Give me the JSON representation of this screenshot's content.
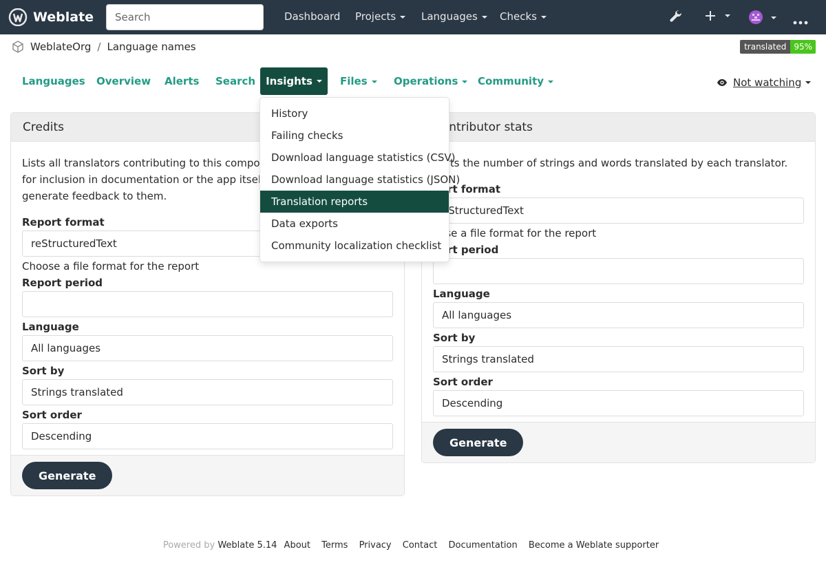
{
  "brand": {
    "name": "Weblate"
  },
  "search": {
    "placeholder": "Search"
  },
  "nav": {
    "dashboard": "Dashboard",
    "projects": "Projects",
    "languages": "Languages",
    "checks": "Checks"
  },
  "breadcrumb": {
    "project": "WeblateOrg",
    "component": "Language names",
    "sep": "/"
  },
  "badge": {
    "label": "translated",
    "value": "95%"
  },
  "tabs": {
    "languages": "Languages",
    "overview": "Overview",
    "alerts": "Alerts",
    "search": "Search",
    "insights": "Insights",
    "files": "Files",
    "operations": "Operations",
    "community": "Community"
  },
  "watch": {
    "label": "Not watching"
  },
  "insights_menu": [
    "History",
    "Failing checks",
    "Download language statistics (CSV)",
    "Download language statistics (JSON)",
    "Translation reports",
    "Data exports",
    "Community localization checklist"
  ],
  "credits": {
    "title": "Credits",
    "description_lines": [
      "Lists all translators contributing to this component in",
      "for inclusion in documentation or the app itself, to th",
      "generate feedback to them."
    ],
    "format_label": "Report format",
    "format_value": "reStructuredText",
    "format_help": "Choose a file format for the report",
    "period_label": "Report period",
    "language_label": "Language",
    "language_value": "All languages",
    "sortby_label": "Sort by",
    "sortby_value": "Strings translated",
    "order_label": "Sort order",
    "order_value": "Descending",
    "generate": "Generate"
  },
  "stats": {
    "title": "Contributor stats",
    "description": "ports the number of strings and words translated by each translator.",
    "format_label": "port format",
    "format_value": "eStructuredText",
    "format_help": "oose a file format for the report",
    "period_label": "port period",
    "language_label": "Language",
    "language_value": "All languages",
    "sortby_label": "Sort by",
    "sortby_value": "Strings translated",
    "order_label": "Sort order",
    "order_value": "Descending",
    "generate": "Generate"
  },
  "footer": {
    "powered_by": "Powered by",
    "version": "Weblate 5.14",
    "about": "About",
    "terms": "Terms",
    "privacy": "Privacy",
    "contact": "Contact",
    "documentation": "Documentation",
    "supporter": "Become a Weblate supporter"
  },
  "colors": {
    "navbar": "#2a3744",
    "accent": "#239b85",
    "active": "#144d3f",
    "badge_green": "#4bc51d"
  },
  "icons": [
    "weblate-logo-icon",
    "wrench-icon",
    "plus-icon",
    "user-avatar-icon",
    "more-icon",
    "eye-icon",
    "project-icon"
  ]
}
